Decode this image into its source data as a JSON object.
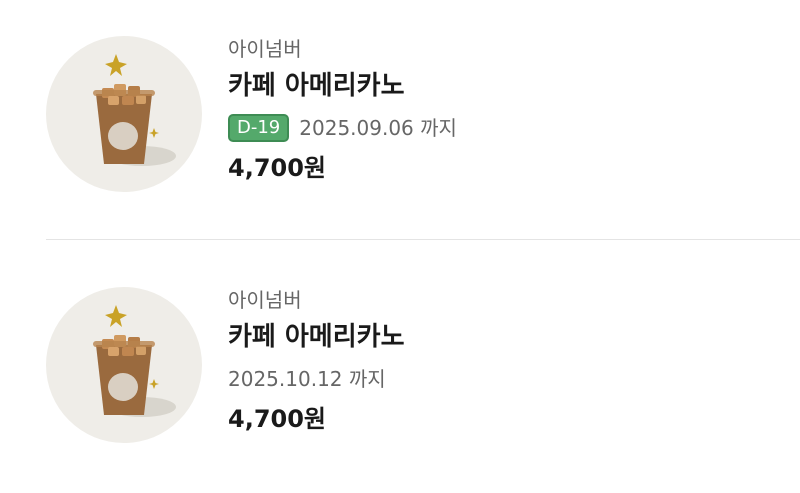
{
  "items": [
    {
      "brand": "아이넘버",
      "title": "카페 아메리카노",
      "dday": "D-19",
      "expiry": "2025.09.06 까지",
      "price": "4,700원",
      "image_icon": "iced-americano-cup-icon"
    },
    {
      "brand": "아이넘버",
      "title": "카페 아메리카노",
      "expiry": "2025.10.12 까지",
      "price": "4,700원",
      "image_icon": "iced-americano-cup-icon"
    }
  ],
  "colors": {
    "dday_badge": "#54a96b",
    "thumbnail_bg": "#efede8",
    "text_primary": "#1a1a1a",
    "text_secondary": "#666666",
    "divider": "#e4e4e4"
  }
}
